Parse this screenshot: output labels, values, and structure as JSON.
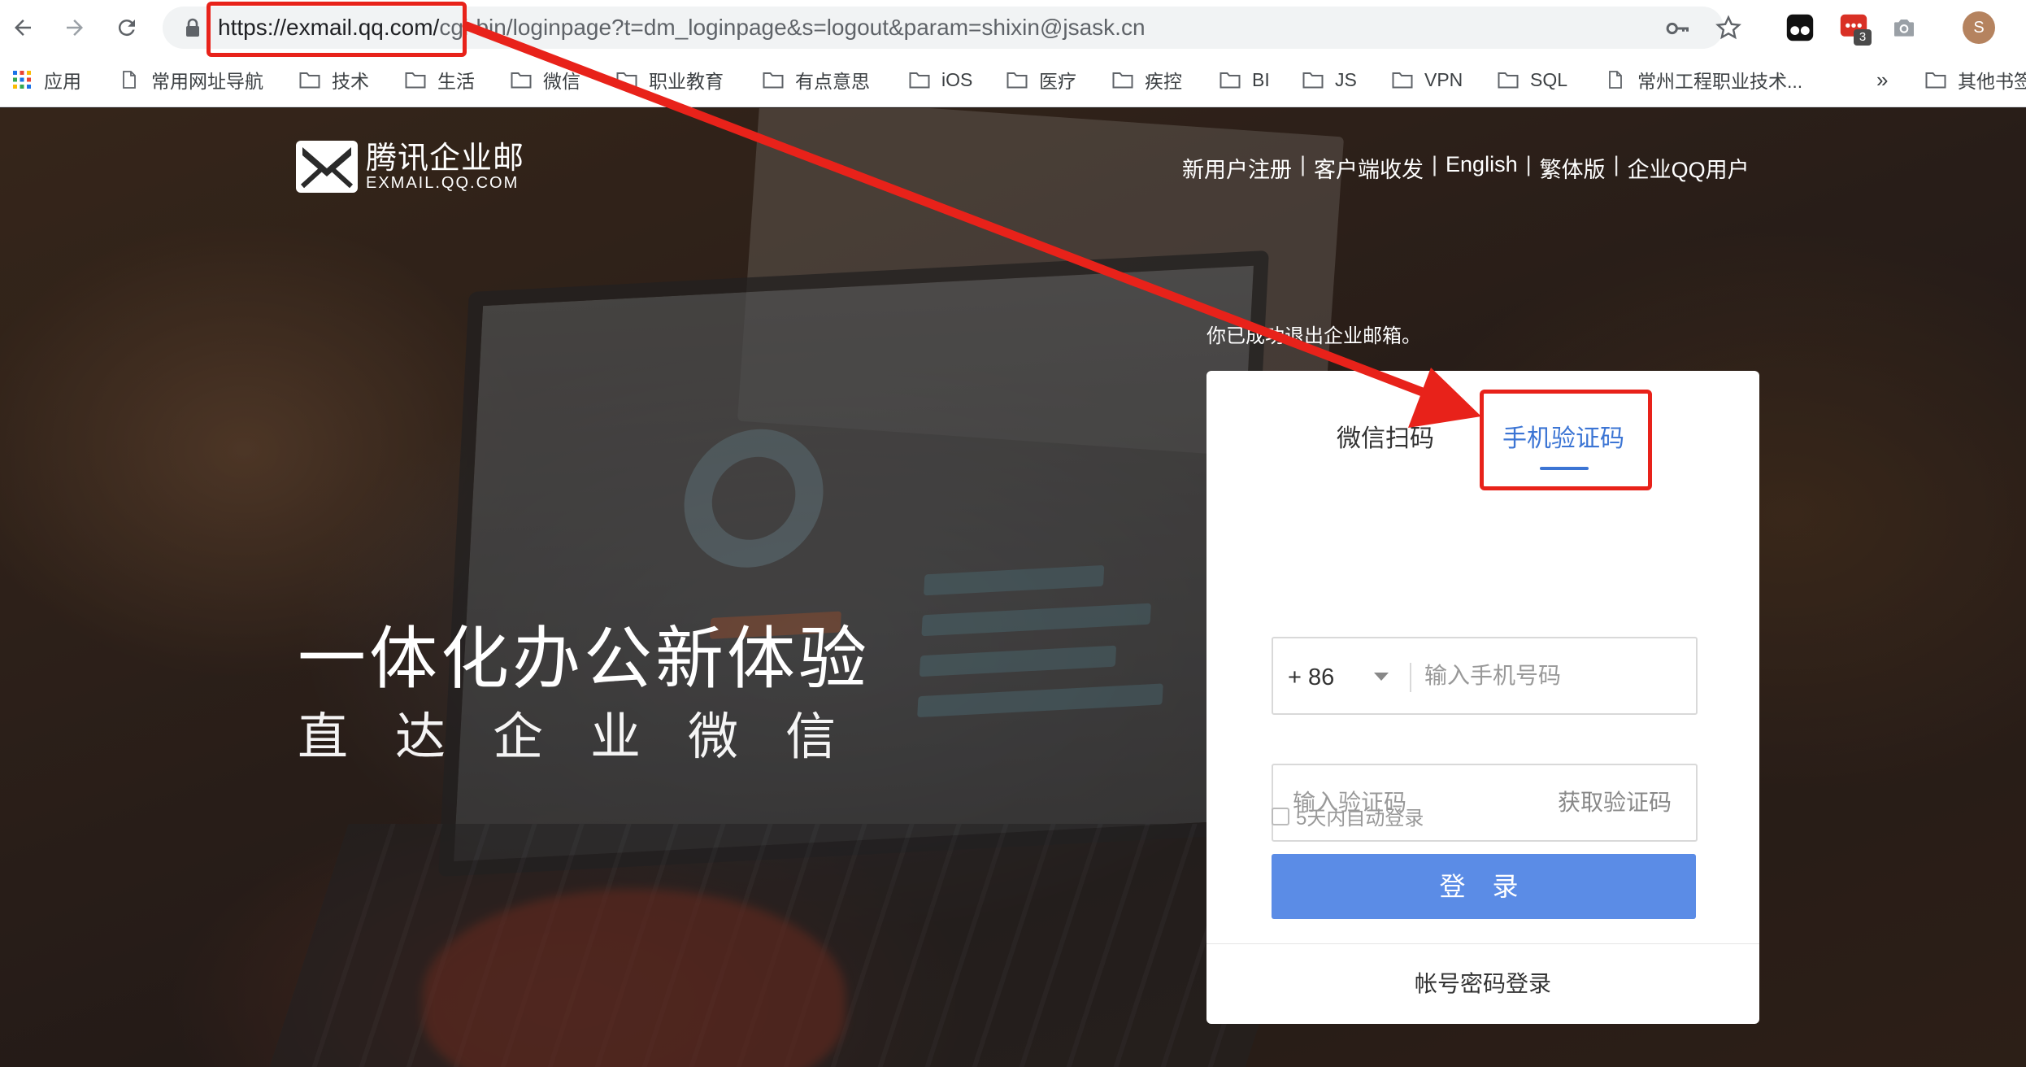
{
  "browser": {
    "url_host": "https://exmail.qq.com/",
    "url_rest": "cgi-bin/loginpage?t=dm_loginpage&s=logout&param=shixin@jsask.cn",
    "extension_badge": "3",
    "avatar_letter": "S"
  },
  "bookmarks": [
    {
      "icon": "apps-grid-icon",
      "label": "应用"
    },
    {
      "icon": "page-icon",
      "label": "常用网址导航"
    },
    {
      "icon": "folder-icon",
      "label": "技术"
    },
    {
      "icon": "folder-icon",
      "label": "生活"
    },
    {
      "icon": "folder-icon",
      "label": "微信"
    },
    {
      "icon": "folder-icon",
      "label": "职业教育"
    },
    {
      "icon": "folder-icon",
      "label": "有点意思"
    },
    {
      "icon": "folder-icon",
      "label": "iOS"
    },
    {
      "icon": "folder-icon",
      "label": "医疗"
    },
    {
      "icon": "folder-icon",
      "label": "疾控"
    },
    {
      "icon": "folder-icon",
      "label": "BI"
    },
    {
      "icon": "folder-icon",
      "label": "JS"
    },
    {
      "icon": "folder-icon",
      "label": "VPN"
    },
    {
      "icon": "folder-icon",
      "label": "SQL"
    },
    {
      "icon": "page-icon",
      "label": "常州工程职业技术..."
    },
    {
      "icon": "folder-icon",
      "label": "其他书签"
    }
  ],
  "bookmarks_more": "»",
  "header": {
    "logo_cn": "腾讯企业邮",
    "logo_en": "EXMAIL.QQ.COM",
    "nav": [
      "新用户注册",
      "客户端收发",
      "English",
      "繁体版",
      "企业QQ用户"
    ],
    "separator": "|"
  },
  "hero": {
    "title": "一体化办公新体验",
    "subtitle_chars": [
      "直",
      "达",
      "企",
      "业",
      "微",
      "信"
    ]
  },
  "logout_message": "你已成功退出企业邮箱。",
  "login": {
    "tabs": [
      {
        "label": "微信扫码",
        "active": false
      },
      {
        "label": "手机验证码",
        "active": true
      }
    ],
    "country_code": "+ 86",
    "phone_placeholder": "输入手机号码",
    "code_placeholder": "输入验证码",
    "get_code_label": "获取验证码",
    "remember_label": "5天内自动登录",
    "login_button": "登 录",
    "password_login": "帐号密码登录"
  },
  "colors": {
    "accent_blue": "#3c75d4",
    "login_button": "#5b8ce6",
    "annotation_red": "#e8221a"
  }
}
